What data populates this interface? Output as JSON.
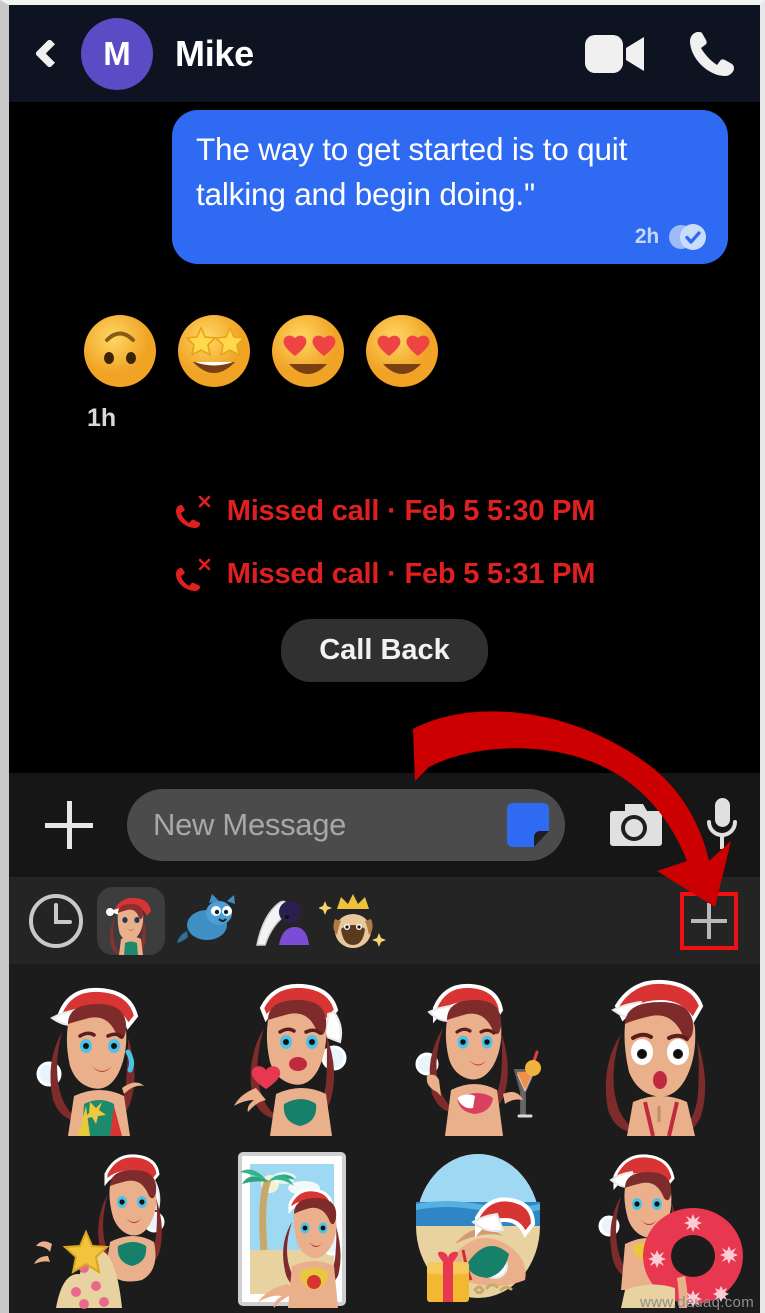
{
  "header": {
    "back_icon": "back-chevron-icon",
    "avatar_initial": "M",
    "avatar_color": "#5b4bc4",
    "contact_name": "Mike",
    "video_icon": "video-camera-icon",
    "call_icon": "phone-icon",
    "background_color": "#0d1320"
  },
  "conversation": {
    "outgoing_message": {
      "text": "The way to get started is to quit talking and begin doing.\"",
      "time": "2h",
      "status_icon": "seen-double-check-icon",
      "bubble_color": "#2f6bf2"
    },
    "reactions": {
      "emojis": [
        "upside-down-face",
        "star-struck",
        "smiling-face-with-heart-eyes",
        "smiling-face-with-heart-eyes"
      ],
      "time": "1h"
    },
    "events": [
      {
        "icon": "missed-call-icon",
        "text": "Missed call · Feb 5 5:30 PM",
        "color": "#e02020"
      },
      {
        "icon": "missed-call-icon",
        "text": "Missed call · Feb 5 5:31 PM",
        "color": "#e02020"
      }
    ],
    "call_back_label": "Call Back"
  },
  "composer": {
    "add_icon": "plus-icon",
    "placeholder": "New Message",
    "value": "",
    "sticker_icon": "sticker-icon",
    "camera_icon": "camera-icon",
    "mic_icon": "microphone-icon"
  },
  "sticker_tabs": {
    "recents_icon": "clock-icon",
    "packs": [
      {
        "name": "santa-girl-pack",
        "selected": true
      },
      {
        "name": "blue-cat-pack",
        "selected": false
      },
      {
        "name": "facepalm-pack",
        "selected": false
      },
      {
        "name": "king-pug-pack",
        "selected": false
      }
    ],
    "add_pack_icon": "plus-icon",
    "add_pack_highlight_color": "#ee1111"
  },
  "sticker_grid": {
    "items": [
      {
        "name": "santa-girl-wink-sticker"
      },
      {
        "name": "santa-girl-blow-kiss-sticker"
      },
      {
        "name": "santa-girl-cocktail-sticker"
      },
      {
        "name": "santa-girl-surprised-sticker"
      },
      {
        "name": "santa-girl-sandcastle-sticker"
      },
      {
        "name": "santa-girl-beach-frame-sticker"
      },
      {
        "name": "santa-girl-gift-beach-sticker"
      },
      {
        "name": "santa-girl-float-ring-sticker"
      }
    ]
  },
  "annotation": {
    "arrow_color": "#cc0000",
    "target": "add-sticker-pack-button"
  },
  "watermark": "www.deuaq.com"
}
